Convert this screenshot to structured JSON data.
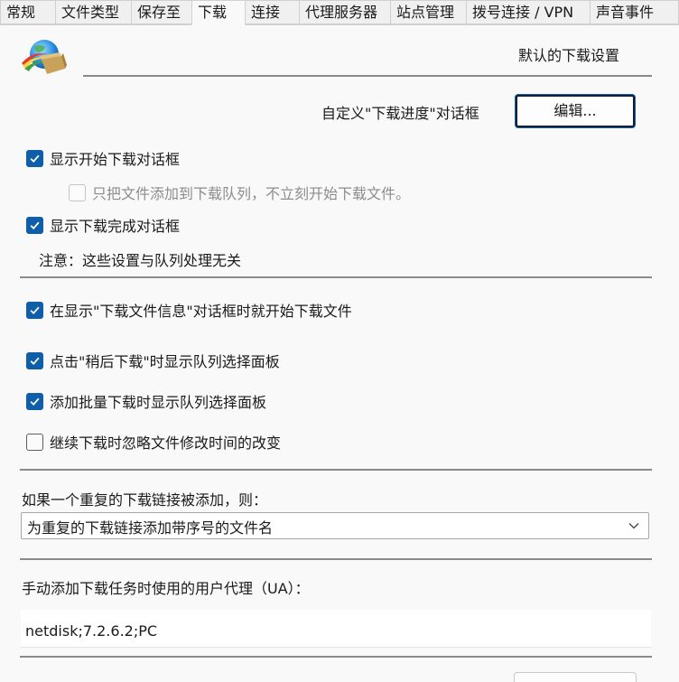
{
  "tabs": [
    {
      "label": "常规"
    },
    {
      "label": "文件类型"
    },
    {
      "label": "保存至"
    },
    {
      "label": "下载",
      "active": true
    },
    {
      "label": "连接"
    },
    {
      "label": "代理服务器"
    },
    {
      "label": "站点管理"
    },
    {
      "label": "拨号连接 / VPN"
    },
    {
      "label": "声音事件"
    }
  ],
  "header": {
    "title": "默认的下载设置",
    "logo_icon": "idm-globe-box-icon"
  },
  "custom_progress": {
    "label": "自定义\"下载进度\"对话框",
    "button_label": "编辑..."
  },
  "options": {
    "show_start_dialog": {
      "label": "显示开始下载对话框",
      "checked": true
    },
    "only_add_to_queue": {
      "label": "只把文件添加到下载队列，不立刻开始下载文件。",
      "checked": false,
      "disabled": true
    },
    "show_complete_dialog": {
      "label": "显示下载完成对话框",
      "checked": true
    },
    "note": "注意：这些设置与队列处理无关",
    "start_on_info_dialog": {
      "label": "在显示\"下载文件信息\"对话框时就开始下载文件",
      "checked": true
    },
    "show_queue_on_later": {
      "label": "点击\"稍后下载\"时显示队列选择面板",
      "checked": true
    },
    "show_queue_on_batch": {
      "label": "添加批量下载时显示队列选择面板",
      "checked": true
    },
    "ignore_mtime_change": {
      "label": "继续下载时忽略文件修改时间的改变",
      "checked": false
    }
  },
  "duplicate": {
    "label": "如果一个重复的下载链接被添加，则：",
    "selected": "为重复的下载链接添加带序号的文件名"
  },
  "user_agent": {
    "label": "手动添加下载任务时使用的用户代理（UA）：",
    "value": "netdisk;7.2.6.2;PC"
  },
  "colors": {
    "checkbox_checked": "#0f5ea9",
    "panel_bg": "#f9f9f9",
    "window_bg": "#f0f0f0"
  }
}
